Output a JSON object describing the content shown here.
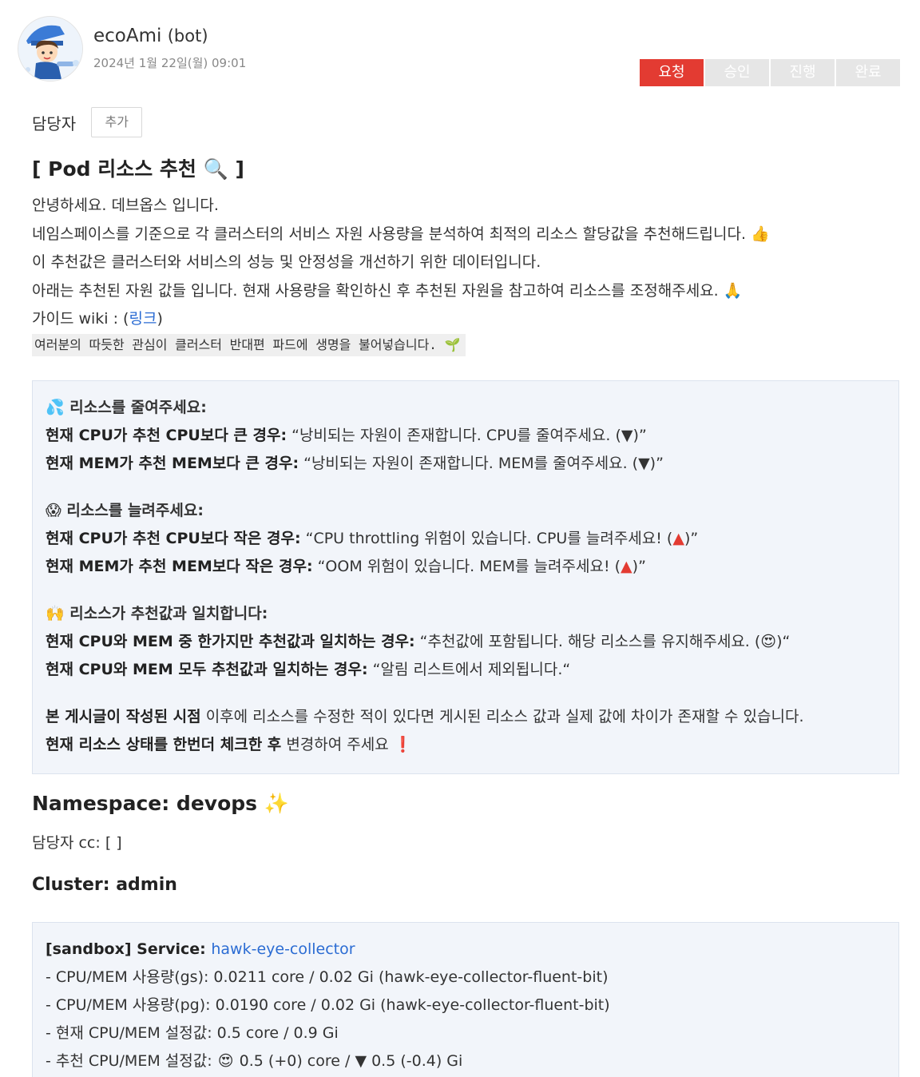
{
  "post": {
    "author": "ecoAmi",
    "author_tag": "(bot)",
    "date": "2024년 1월 22일(월) 09:01"
  },
  "status_steps": [
    "요청",
    "승인",
    "진행",
    "완료"
  ],
  "assignee": {
    "label": "담당자",
    "add_button": "추가"
  },
  "title": "[ Pod 리소스 추천 🔍 ]",
  "intro": {
    "line1": "안녕하세요. 데브옵스 입니다.",
    "line2": "네임스페이스를 기준으로 각 클러스터의 서비스 자원 사용량을 분석하여 최적의 리소스 할당값을 추천해드립니다. 👍",
    "line3": "이 추천값은 클러스터와 서비스의 성능 및 안정성을 개선하기 위한 데이터입니다.",
    "line4": "아래는 추천된 자원 값들 입니다. 현재 사용량을 확인하신 후 추천된 자원을 참고하여 리소스를 조정해주세요. 🙏",
    "guide_prefix": "가이드 wiki : (",
    "guide_link": "링크",
    "guide_suffix": ")",
    "code_line": "여러분의 따듯한 관심이 클러스터 반대편 파드에 생명을 불어넣습니다. 🌱"
  },
  "guide_box": {
    "reduce": {
      "heading": "💦 리소스를 줄여주세요:",
      "cpu_label": "현재 CPU가 추천 CPU보다 큰 경우:",
      "cpu_text": " “낭비되는 자원이 존재합니다. CPU를 줄여주세요. (▼)”",
      "mem_label": "현재 MEM가 추천 MEM보다 큰 경우:",
      "mem_text": " “낭비되는 자원이 존재합니다. MEM를 줄여주세요. (▼)”"
    },
    "increase": {
      "heading": "😱 리소스를 늘려주세요:",
      "cpu_label": "현재 CPU가 추천 CPU보다 작은 경우:",
      "cpu_text_pre": " “CPU throttling 위험이 있습니다. CPU를 늘려주세요! (",
      "mem_label": "현재 MEM가 추천 MEM보다 작은 경우:",
      "mem_text_pre": " “OOM 위험이 있습니다. MEM를 늘려주세요! (",
      "triangle": "▲",
      "close": ")”"
    },
    "match": {
      "heading": "🙌 리소스가 추천값과 일치합니다:",
      "partial_label": "현재 CPU와 MEM 중 한가지만 추천값과 일치하는 경우:",
      "partial_text": " “추천값에 포함됩니다. 해당 리소스를 유지해주세요. (😍)“",
      "all_label": "현재 CPU와 MEM 모두 추천값과 일치하는 경우:",
      "all_text": " “알림 리스트에서 제외됩니다.“"
    },
    "notice": {
      "bold1": "본 게시글이 작성된 시점",
      "text1": " 이후에 리소스를 수정한 적이 있다면 게시된 리소스 값과 실제 값에 차이가 존재할 수 있습니다.",
      "bold2": "현재 리소스 상태를 한번더 체크한 후",
      "text2": " 변경하여 주세요 ",
      "mark": "❗"
    }
  },
  "namespace": {
    "label": "Namespace: devops",
    "sparkle": "✨"
  },
  "cc": "담당자 cc: [  ]",
  "cluster": "Cluster: admin",
  "service": {
    "prefix": "[sandbox] Service: ",
    "name": "hawk-eye-collector",
    "usage_gs": "- CPU/MEM 사용량(gs): 0.0211 core / 0.02 Gi (hawk-eye-collector-fluent-bit)",
    "usage_pg": "- CPU/MEM 사용량(pg): 0.0190 core / 0.02 Gi (hawk-eye-collector-fluent-bit)",
    "current": "- 현재 CPU/MEM 설정값: 0.5 core / 0.9 Gi",
    "recommend_prefix": "- 추천 CPU/MEM 설정값: ",
    "recommend_emoji": "😍",
    "recommend_value": " 0.5 (+0) core / ▼ 0.5 (-0.4) Gi"
  },
  "colors": {
    "accent_red": "#e33b32",
    "link_blue": "#2b6cd3",
    "box_bg": "#f2f5fa"
  }
}
